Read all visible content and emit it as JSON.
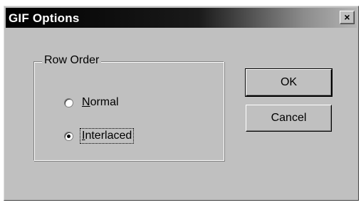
{
  "window": {
    "title": "GIF Options",
    "close_glyph": "×"
  },
  "group": {
    "label": "Row Order",
    "options": [
      {
        "label_first": "N",
        "label_rest": "ormal",
        "selected": false
      },
      {
        "label_first": "I",
        "label_rest": "nterlaced",
        "selected": true
      }
    ]
  },
  "buttons": {
    "ok": "OK",
    "cancel": "Cancel"
  }
}
